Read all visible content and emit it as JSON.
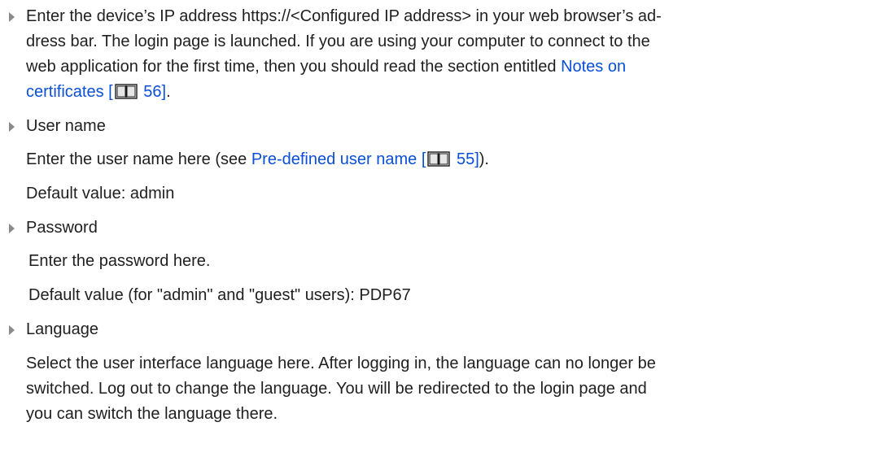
{
  "items": [
    {
      "text_before": "Enter the device’s IP address https://<Configured IP address> in your web browser’s ad-",
      "line2": "dress bar. The login page is launched. If you are using your computer to connect to the",
      "line3_before": "web application for the first time, then you should read the section entitled ",
      "link_part1": "Notes on",
      "link_part2": "certificates [",
      "link_page": " 56]",
      "text_after": "."
    }
  ],
  "user_name": {
    "heading": "User name",
    "desc_before": "Enter the user name here (see ",
    "link_text": "Pre-defined user name [",
    "link_page": " 55]",
    "desc_after": ").",
    "default": "Default value: admin"
  },
  "password": {
    "heading": "Password",
    "desc": "Enter the password here.",
    "default": "Default value (for \"admin\" and \"guest\" users): PDP67"
  },
  "language": {
    "heading": "Language",
    "line1": "Select the user interface language here. After logging in, the language can no longer be",
    "line2": "switched. Log out to change the language. You will be redirected to the login page and",
    "line3": "you can switch the language there."
  },
  "colors": {
    "link": "#0a4fd6",
    "bullet": "#8a8a8a",
    "text": "#1f1f1f"
  }
}
